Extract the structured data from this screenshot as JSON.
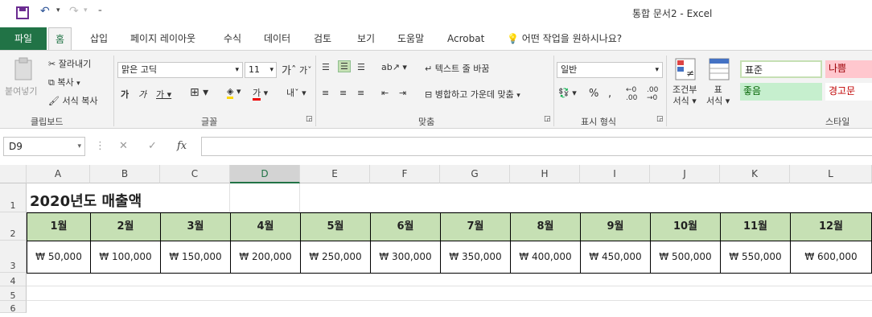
{
  "window": {
    "title": "통합 문서2  -  Excel"
  },
  "tabs": [
    "파일",
    "홈",
    "삽입",
    "페이지 레이아웃",
    "수식",
    "데이터",
    "검토",
    "보기",
    "도움말",
    "Acrobat"
  ],
  "tell_me": "어떤 작업을 원하시나요?",
  "ribbon": {
    "clipboard": {
      "paste": "붙여넣기",
      "cut": "잘라내기",
      "copy": "복사",
      "format_painter": "서식 복사",
      "label": "클립보드"
    },
    "font": {
      "name": "맑은 고딕",
      "size": "11",
      "label": "글꼴"
    },
    "alignment": {
      "wrap_text": "텍스트 줄 바꿈",
      "merge_center": "병합하고 가운데 맞춤",
      "label": "맞춤"
    },
    "number": {
      "format": "일반",
      "label": "표시 형식"
    },
    "cond_format": {
      "line1": "조건부",
      "line2": "서식"
    },
    "table_format": {
      "line1": "표",
      "line2": "서식"
    },
    "styles": {
      "normal": "표준",
      "bad": "나쁨",
      "good": "좋음",
      "warning": "경고문",
      "label": "스타일"
    }
  },
  "formula_bar": {
    "name_box": "D9",
    "fx": "fx",
    "value": ""
  },
  "columns": [
    "A",
    "B",
    "C",
    "D",
    "E",
    "F",
    "G",
    "H",
    "I",
    "J",
    "K",
    "L"
  ],
  "rows": [
    "1",
    "2",
    "3",
    "4",
    "5",
    "6"
  ],
  "sheet": {
    "title": "2020년도 매출액",
    "months": [
      "1월",
      "2월",
      "3월",
      "4월",
      "5월",
      "6월",
      "7월",
      "8월",
      "9월",
      "10월",
      "11월",
      "12월"
    ],
    "values": [
      "₩ 50,000",
      "₩ 100,000",
      "₩ 150,000",
      "₩ 200,000",
      "₩ 250,000",
      "₩ 300,000",
      "₩ 350,000",
      "₩ 400,000",
      "₩ 450,000",
      "₩ 500,000",
      "₩ 550,000",
      "₩ 600,000"
    ]
  },
  "colors": {
    "accent": "#217346",
    "header_fill": "#c6e0b4",
    "good_fill": "#c6efce",
    "bad_fill": "#ffc7ce"
  }
}
